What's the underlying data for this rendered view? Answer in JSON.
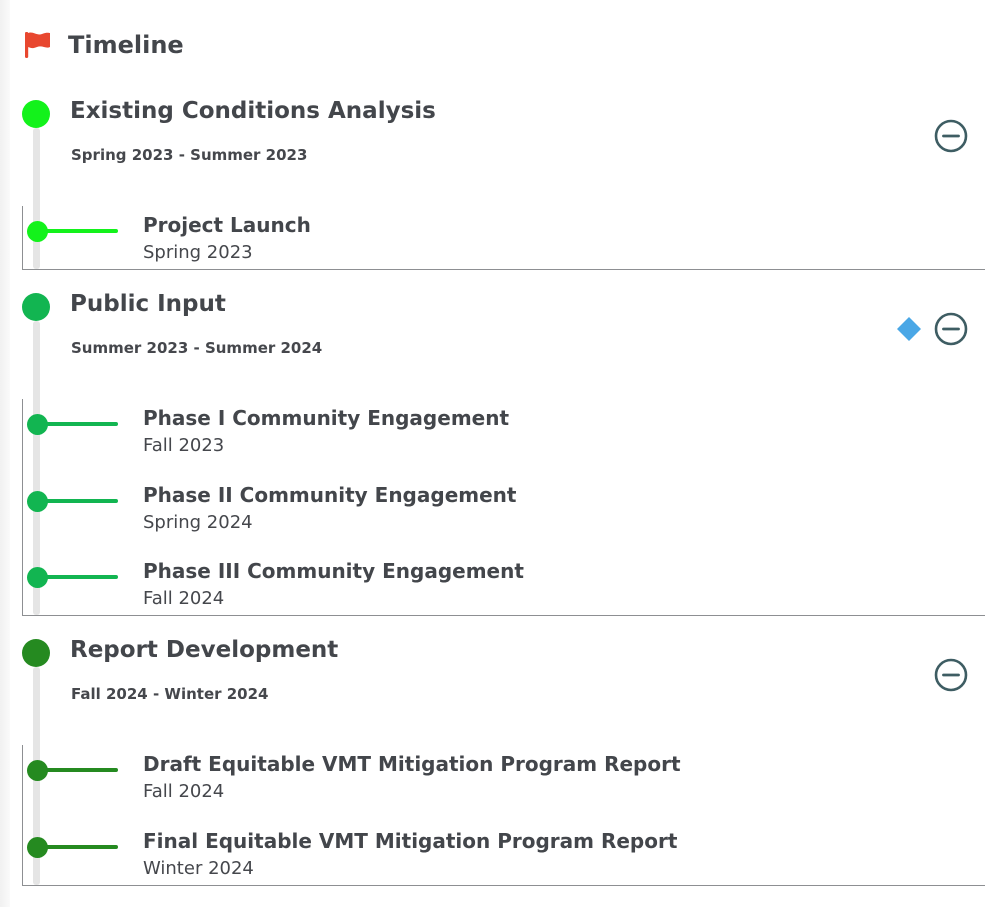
{
  "header": {
    "title": "Timeline",
    "icon": "flag-icon",
    "icon_color": "#e8472f"
  },
  "phases": [
    {
      "title": "Existing Conditions Analysis",
      "range": "Spring 2023 - Summer 2023",
      "color": "#13f21b",
      "has_marker": false,
      "milestones": [
        {
          "title": "Project Launch",
          "date": "Spring 2023"
        }
      ]
    },
    {
      "title": "Public Input",
      "range": "Summer 2023 - Summer 2024",
      "color": "#12b551",
      "has_marker": true,
      "marker_color": "#4aa7e6",
      "milestones": [
        {
          "title": "Phase I Community Engagement",
          "date": "Fall 2023"
        },
        {
          "title": "Phase II Community Engagement",
          "date": "Spring 2024"
        },
        {
          "title": "Phase III Community Engagement",
          "date": "Fall 2024"
        }
      ]
    },
    {
      "title": "Report Development",
      "range": "Fall 2024 - Winter 2024",
      "color": "#258a20",
      "has_marker": false,
      "milestones": [
        {
          "title": "Draft Equitable VMT Mitigation Program Report",
          "date": "Fall 2024"
        },
        {
          "title": "Final Equitable VMT Mitigation Program Report",
          "date": "Winter 2024"
        }
      ]
    }
  ],
  "collapse_icon": "minus-circle-icon",
  "collapse_icon_color": "#3e5d63",
  "marker_icon": "diamond-icon"
}
